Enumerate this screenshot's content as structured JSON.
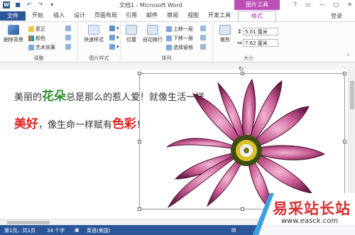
{
  "window": {
    "title": "文档1 - Microsoft Word",
    "contextual_tab_group": "图片工具",
    "login": "登录",
    "controls": [
      "?",
      "▭",
      "—",
      "▢",
      "✕"
    ]
  },
  "tabs": {
    "file": "文件",
    "items": [
      "开始",
      "插入",
      "设计",
      "页面布局",
      "引用",
      "邮件",
      "审阅",
      "视图",
      "开发工具"
    ],
    "format": "格式"
  },
  "ribbon": {
    "remove_bg": "删除背景",
    "adjust_items": [
      "更正",
      "颜色",
      "艺术效果"
    ],
    "adjust_label": "调整",
    "quick_styles": "快速样式",
    "picture_styles_label": "图片样式",
    "position": "位置",
    "wrap_text": "自动换行",
    "arrange_items": [
      "上移一层",
      "下移一层",
      "选择窗格"
    ],
    "arrange_label": "排列",
    "crop": "裁剪",
    "height_value": "5.01 厘米",
    "width_value": "7.62 厘米",
    "size_label": "大小"
  },
  "document": {
    "line1_a": "美丽的",
    "line1_b": "花朵",
    "line1_c": "总是那么的惹人爱！就像生活一样",
    "line2_a": "美好",
    "line2_b": "，像生命一样赋有",
    "line2_c": "色彩",
    "line2_d": "！"
  },
  "status": {
    "page": "第1页，共1页",
    "words": "34 个字",
    "language": "英语(美国)"
  },
  "watermark": {
    "text": "易采站长站",
    "url": "www.easck.com"
  },
  "colors": {
    "word_blue": "#2b579a",
    "picture_tools": "#bc4fb7",
    "green_text": "#2e8b2e",
    "red_text": "#e02020"
  }
}
